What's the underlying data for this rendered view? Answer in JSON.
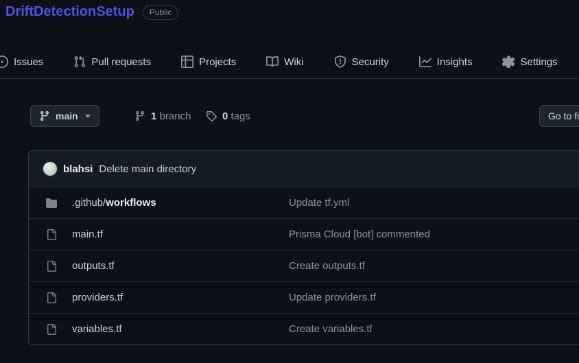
{
  "colors": {
    "page_bg": "#0d1117",
    "panel_bg": "#161b22",
    "border": "#30363d",
    "row_border": "#21262d",
    "text": "#c9d1d9",
    "muted": "#8b949e",
    "title_link": "#4a54e1",
    "button_bg": "#21262d",
    "icon_folder": "#768390",
    "icon_file": "#6e7681"
  },
  "repo": {
    "name": "DriftDetectionSetup",
    "visibility": "Public"
  },
  "nav": {
    "items": [
      {
        "label": "Issues",
        "icon": "issue-opened-icon"
      },
      {
        "label": "Pull requests",
        "icon": "git-pull-request-icon"
      },
      {
        "label": "Projects",
        "icon": "project-table-icon"
      },
      {
        "label": "Wiki",
        "icon": "book-icon"
      },
      {
        "label": "Security",
        "icon": "shield-icon"
      },
      {
        "label": "Insights",
        "icon": "graph-icon"
      },
      {
        "label": "Settings",
        "icon": "gear-icon"
      }
    ]
  },
  "branch_bar": {
    "current_branch": "main",
    "branch_count": "1",
    "branch_word": "branch",
    "tag_count": "0",
    "tag_word": "tags",
    "go_to_file": "Go to file"
  },
  "latest_commit": {
    "author": "blahsi",
    "message": "Delete main directory"
  },
  "files": [
    {
      "prefix": ".github/",
      "name": "workflows",
      "icon": "folder-icon",
      "commit_message": "Update tf.yml"
    },
    {
      "prefix": "",
      "name": "main.tf",
      "icon": "file-icon",
      "commit_message": "Prisma Cloud [bot] commented"
    },
    {
      "prefix": "",
      "name": "outputs.tf",
      "icon": "file-icon",
      "commit_message": "Create outputs.tf"
    },
    {
      "prefix": "",
      "name": "providers.tf",
      "icon": "file-icon",
      "commit_message": "Update providers.tf"
    },
    {
      "prefix": "",
      "name": "variables.tf",
      "icon": "file-icon",
      "commit_message": "Create variables.tf"
    }
  ]
}
